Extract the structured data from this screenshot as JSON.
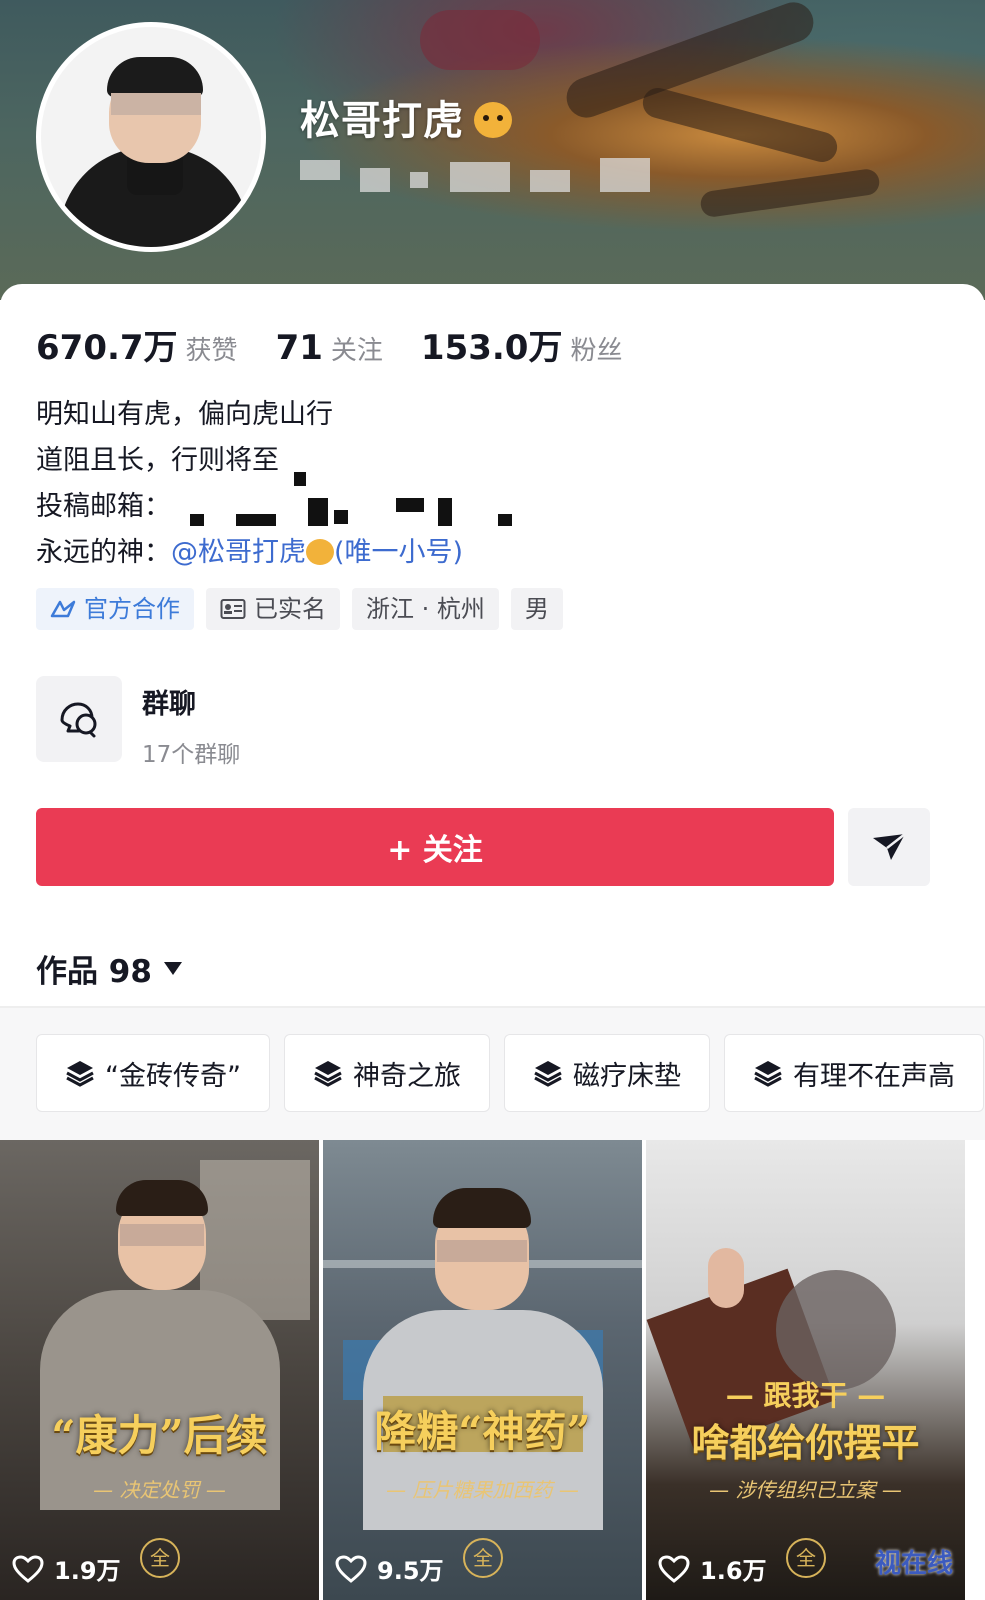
{
  "profile": {
    "name": "松哥打虎",
    "avatar_icon": "avatar-photo",
    "name_emoji": "tiger-face-emoji"
  },
  "stats": {
    "likes_value": "670.7万",
    "likes_label": "获赞",
    "following_value": "71",
    "following_label": "关注",
    "followers_value": "153.0万",
    "followers_label": "粉丝"
  },
  "bio": {
    "line1": "明知山有虎，偏向虎山行",
    "line2": "道阻且长，行则将至",
    "line3_label": "投稿邮箱：",
    "line4_label": "永远的神：",
    "line4_mention": "@松哥打虎",
    "line4_suffix": "(唯一小号)"
  },
  "tags": {
    "official": "官方合作",
    "verified": "已实名",
    "location": "浙江 · 杭州",
    "gender": "男"
  },
  "group": {
    "title": "群聊",
    "subtitle": "17个群聊"
  },
  "actions": {
    "follow": "+ 关注",
    "share_icon": "send-arrow-icon"
  },
  "works": {
    "label": "作品 98"
  },
  "collections": [
    "“金砖传奇”",
    "神奇之旅",
    "磁疗床垫",
    "有理不在声高"
  ],
  "videos": [
    {
      "headline": "“康力”后续",
      "subline": "— 决定处罚 —",
      "likes": "1.9万",
      "seal": "全"
    },
    {
      "headline": "降糖“神药”",
      "subline": "— 压片糖果加西药 —",
      "likes": "9.5万",
      "seal": "全"
    },
    {
      "topline": "— 跟我干 —",
      "headline": "啥都给你摆平",
      "subline": "— 涉传组织已立案 —",
      "likes": "1.6万",
      "seal": "全"
    }
  ],
  "watermark": "视在线",
  "colors": {
    "follow_button": "#ea3b54",
    "link": "#3d6bcf",
    "official_tag": "#3d7bd9",
    "headline_gold": "#f6cf5c"
  }
}
